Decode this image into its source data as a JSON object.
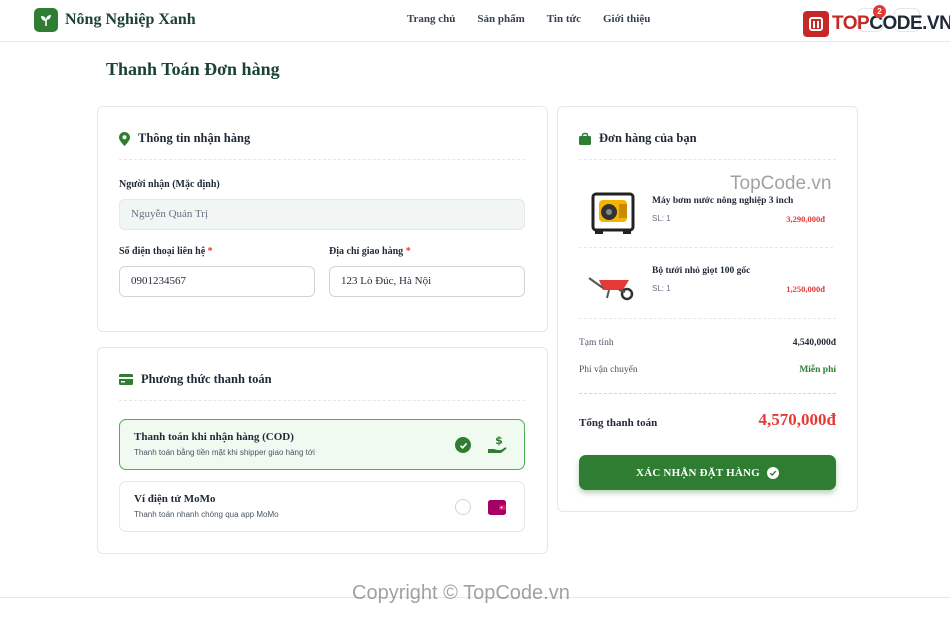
{
  "brand": {
    "name": "Nông Nghiệp Xanh"
  },
  "nav": [
    {
      "label": "Trang chủ"
    },
    {
      "label": "Sản phẩm"
    },
    {
      "label": "Tin tức"
    },
    {
      "label": "Giới thiệu"
    }
  ],
  "cart": {
    "count": "2"
  },
  "watermark": {
    "logo_prefix": "TOP",
    "logo_suffix": "CODE.VN",
    "text_mid": "TopCode.vn",
    "copyright": "Copyright © TopCode.vn"
  },
  "page": {
    "title": "Thanh Toán Đơn hàng"
  },
  "shipping": {
    "title": "Thông tin nhận hàng",
    "receiver_label": "Người nhận (Mặc định)",
    "receiver_value": "Nguyễn Quản Trị",
    "phone_label": "Số điện thoại liên hệ",
    "phone_value": "0901234567",
    "address_label": "Địa chỉ giao hàng",
    "address_value": "123 Lò Đúc, Hà Nội",
    "required_mark": "*"
  },
  "payment": {
    "title": "Phương thức thanh toán",
    "options": [
      {
        "title": "Thanh toán khi nhận hàng (COD)",
        "desc": "Thanh toán bằng tiền mặt khi shipper giao hàng tới",
        "selected": true,
        "icon": "cash-hand-icon"
      },
      {
        "title": "Ví điện tử MoMo",
        "desc": "Thanh toán nhanh chóng qua app MoMo",
        "selected": false,
        "icon": "wallet-icon"
      }
    ]
  },
  "order": {
    "title": "Đơn hàng của bạn",
    "items": [
      {
        "name": "Máy bơm nước nông nghiệp 3 inch",
        "qty": "SL: 1",
        "price": "3,290,000đ",
        "icon": "water-pump-icon"
      },
      {
        "name": "Bộ tưới nhỏ giọt 100 gốc",
        "qty": "SL: 1",
        "price": "1,250,000đ",
        "icon": "wheelbarrow-icon"
      }
    ],
    "subtotal_label": "Tạm tính",
    "subtotal_value": "4,540,000đ",
    "shipping_label": "Phí vận chuyển",
    "shipping_value": "Miễn phí",
    "total_label": "Tổng thanh toán",
    "total_value": "4,570,000đ",
    "confirm_label": "XÁC NHẬN ĐẶT HÀNG"
  },
  "colors": {
    "primary": "#2e7d32",
    "danger": "#e53935",
    "dark": "#1b4332"
  }
}
